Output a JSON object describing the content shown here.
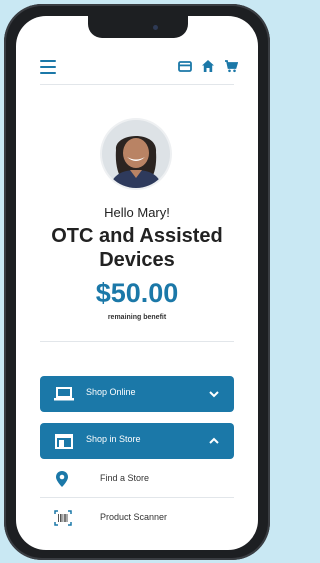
{
  "greeting": "Hello Mary!",
  "title": "OTC and Assisted Devices",
  "benefit": {
    "amount": "$50.00",
    "label": "remaining benefit"
  },
  "buttons": {
    "shop_online": "Shop Online",
    "shop_in_store": "Shop in Store"
  },
  "store_options": [
    {
      "label": "Find a Store",
      "icon": "location-pin-icon"
    },
    {
      "label": "Product Scanner",
      "icon": "barcode-scanner-icon"
    }
  ],
  "header_icons": [
    "menu-icon",
    "card-icon",
    "home-icon",
    "cart-icon"
  ],
  "colors": {
    "accent": "#1b78a8",
    "background": "#c9e8f3",
    "device": "#1d1f22"
  }
}
